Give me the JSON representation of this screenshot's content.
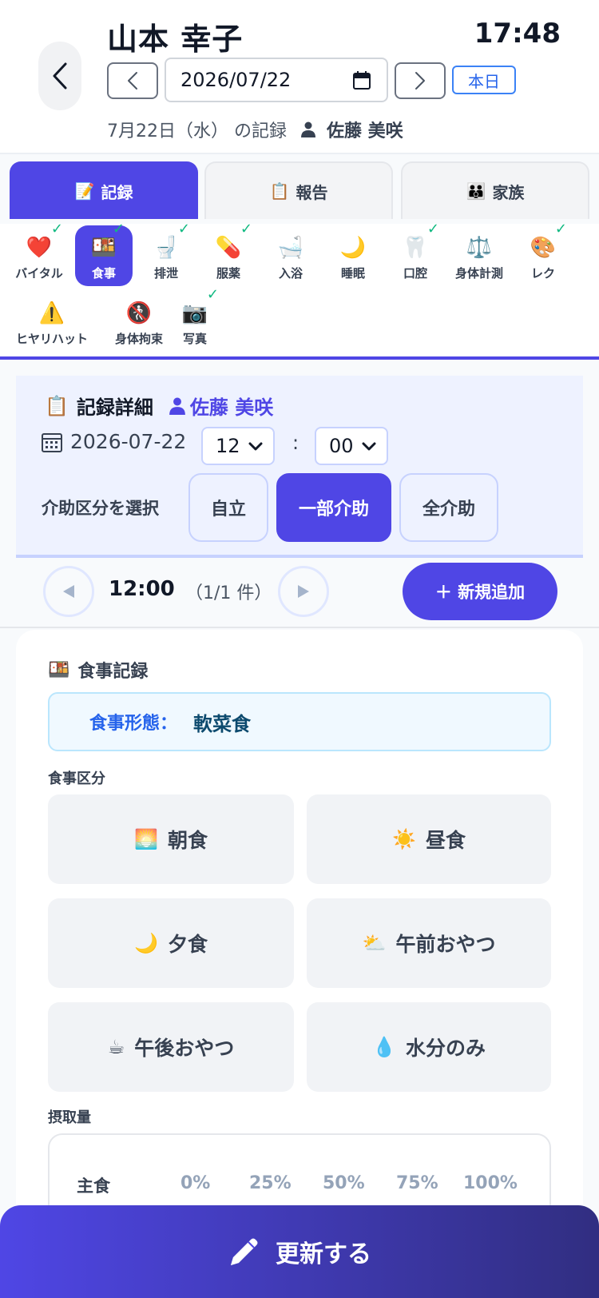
{
  "header": {
    "resident_name": "山本 幸子",
    "clock": "17:48",
    "date_value": "2026/07/22",
    "today_label": "本日",
    "subline_date": "7月22日（水） の記録",
    "staff_name": "佐藤 美咲"
  },
  "main_tabs": [
    {
      "label": "記録",
      "icon": "📝"
    },
    {
      "label": "報告",
      "icon": "📋"
    },
    {
      "label": "家族",
      "icon": "👪"
    }
  ],
  "categories": [
    {
      "label": "バイタル",
      "icon": "❤️",
      "checked": true
    },
    {
      "label": "食事",
      "icon": "🍱",
      "checked": true
    },
    {
      "label": "排泄",
      "icon": "🚽",
      "checked": true
    },
    {
      "label": "服薬",
      "icon": "💊",
      "checked": true
    },
    {
      "label": "入浴",
      "icon": "🛁",
      "checked": false
    },
    {
      "label": "睡眠",
      "icon": "🌙",
      "checked": false
    },
    {
      "label": "口腔",
      "icon": "🦷",
      "checked": true
    },
    {
      "label": "身体計測",
      "icon": "⚖️",
      "checked": false
    },
    {
      "label": "レク",
      "icon": "🎨",
      "checked": true
    },
    {
      "label": "ヒヤリハット",
      "icon": "⚠️",
      "checked": false
    },
    {
      "label": "身体拘束",
      "icon": "🚷",
      "checked": false
    },
    {
      "label": "写真",
      "icon": "📷",
      "checked": true
    }
  ],
  "detail": {
    "title": "記録詳細",
    "staff_name": "佐藤 美咲",
    "date": "2026-07-22",
    "hour": "12",
    "colon": ":",
    "minute": "00",
    "assist_label": "介助区分を選択",
    "assist_options": [
      "自立",
      "一部介助",
      "全介助"
    ]
  },
  "timenav": {
    "time": "12:00",
    "count": "（1/1 件）",
    "add_label": "＋ 新規追加"
  },
  "meal": {
    "title": "食事記録",
    "form_key": "食事形態：",
    "form_value": "軟菜食",
    "category_label": "食事区分",
    "options": [
      {
        "label": "朝食",
        "icon": "🌅"
      },
      {
        "label": "昼食",
        "icon": "☀️"
      },
      {
        "label": "夕食",
        "icon": "🌙"
      },
      {
        "label": "午前おやつ",
        "icon": "⛅"
      },
      {
        "label": "午後おやつ",
        "icon": "☕"
      },
      {
        "label": "水分のみ",
        "icon": "💧"
      }
    ],
    "intake_label": "摂取量",
    "intake_row_label": "主食",
    "intake_levels": [
      "0%",
      "25%",
      "50%",
      "75%",
      "100%"
    ]
  },
  "update_label": "更新する",
  "colors": {
    "accent": "#4f46e5",
    "check": "#10b981",
    "info": "#2563eb"
  }
}
